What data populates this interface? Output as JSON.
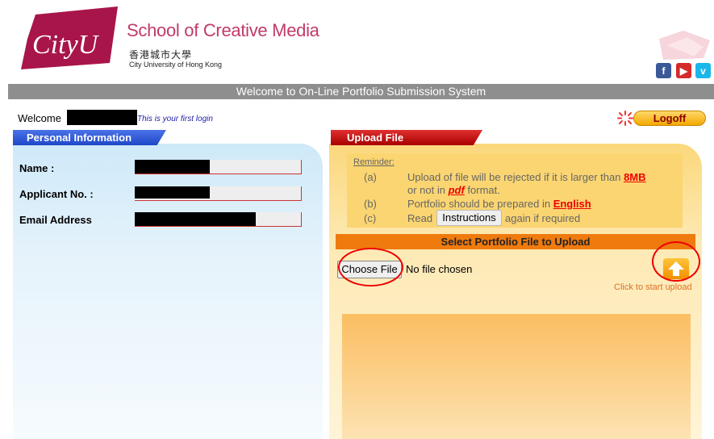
{
  "header": {
    "logo_text": "CityU",
    "school_name": "School of Creative Media",
    "university_cn": "香港城市大學",
    "university_en": "City University of Hong Kong",
    "social": [
      {
        "icon": "facebook-icon",
        "glyph": "f"
      },
      {
        "icon": "youtube-icon",
        "glyph": "▶"
      },
      {
        "icon": "vimeo-icon",
        "glyph": "v"
      }
    ],
    "title": "Welcome to On-Line Portfolio Submission System"
  },
  "welcome": {
    "label": "Welcome",
    "first_login": "This is your first login",
    "logoff_label": "Logoff"
  },
  "personal_info": {
    "tab_label": "Personal Information",
    "fields": [
      {
        "label": "Name :"
      },
      {
        "label": "Applicant No. :"
      },
      {
        "label": "Email Address"
      }
    ]
  },
  "upload": {
    "tab_label": "Upload File",
    "reminder_title": "Reminder:",
    "items": [
      {
        "letter": "(a)",
        "text1": "Upload of file will be rejected if it is larger than ",
        "link1": "8MB",
        "text2": "or not in ",
        "link2": "pdf",
        "text3": " format."
      },
      {
        "letter": "(b)",
        "text1": "Portfolio should be prepared in ",
        "link1": "English"
      },
      {
        "letter": "(c)",
        "text1": "Read",
        "button": "Instructions",
        "text2": "again if required"
      }
    ],
    "select_bar": "Select Portfolio File to Upload",
    "choose_file_label": "Choose File",
    "no_file_text": "No file chosen",
    "click_to_upload": "Click to start upload"
  },
  "colors": {
    "title_bar": "#8e8e8e",
    "accent_red": "#e00000",
    "accent_orange": "#ef7a0e",
    "personal_tab": "#1e48c8",
    "upload_tab": "#a80000"
  }
}
